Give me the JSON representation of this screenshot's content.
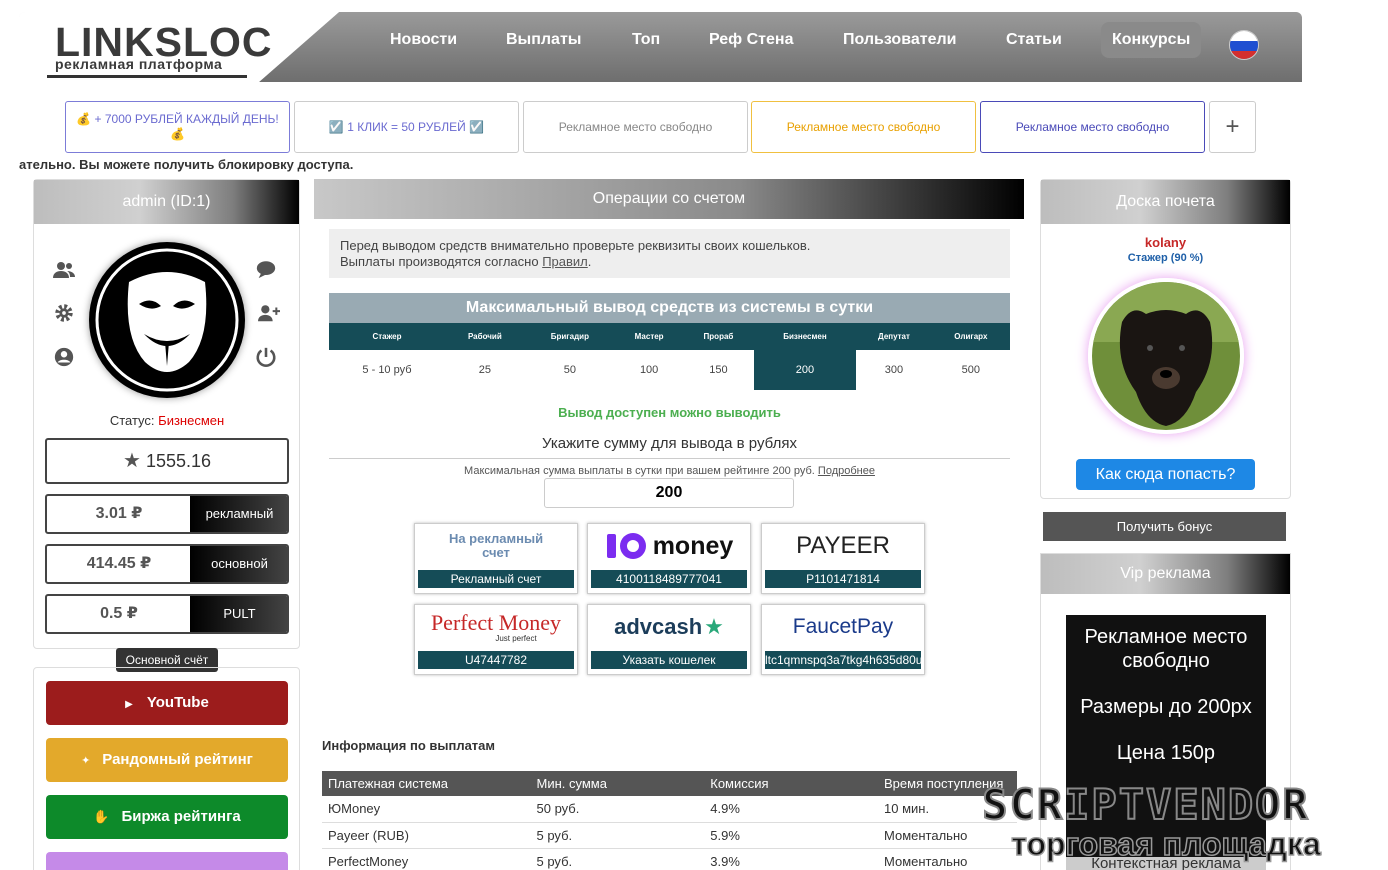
{
  "header": {
    "logo": "LINKSLOC",
    "logo_sub": "рекламная платформа",
    "nav": [
      "Новости",
      "Выплаты",
      "Топ",
      "Реф Стена",
      "Пользователи",
      "Статьи",
      "Конкурсы"
    ]
  },
  "banners": [
    "💰 + 7000 РУБЛЕЙ КАЖДЫЙ ДЕНЬ! 💰",
    "☑️ 1 КЛИК = 50 РУБЛЕЙ ☑️",
    "Рекламное место свободно",
    "Рекламное место свободно",
    "Рекламное место свободно",
    "+"
  ],
  "marquee": "ательно. Вы можете получить блокировку доступа.",
  "profile": {
    "title": "admin (ID:1)",
    "status_label": "Статус:",
    "status_value": "Бизнесмен",
    "rating": "1555.16",
    "balances": [
      {
        "value": "3.01 ₽",
        "tag": "рекламный"
      },
      {
        "value": "414.45 ₽",
        "tag": "основной"
      },
      {
        "value": "0.5 ₽",
        "tag": "PULT"
      }
    ],
    "tooltip": "Основной счёт"
  },
  "menu": [
    "YouTube",
    "Рандомный рейтинг",
    "Биржа рейтинга"
  ],
  "operations": {
    "title": "Операции со счетом",
    "notice_line1": "Перед выводом средств внимательно проверьте реквизиты своих кошельков.",
    "notice_line2": "Выплаты производятся согласно",
    "notice_link": "Правил",
    "max_title": "Максимальный вывод средств из системы в сутки",
    "ranks": [
      "Стажер",
      "Рабочий",
      "Бригадир",
      "Мастер",
      "Прораб",
      "Бизнесмен",
      "Депутат",
      "Олигарх"
    ],
    "limits": [
      "5 - 10 руб",
      "25",
      "50",
      "100",
      "150",
      "200",
      "300",
      "500"
    ],
    "available": "Вывод доступен можно выводить",
    "amount_title": "Укажите сумму для вывода в рублях",
    "max_note": "Максимальная сумма выплаты в сутки при вашем рейтинге 200 руб.",
    "max_note_link": "Подробнее",
    "amount": "200",
    "pay_labels": [
      "Рекламный счет",
      "4100118489777041",
      "P1101471814",
      "U47447782",
      "Указать кошелек",
      "ltc1qmnspq3a7tkg4h635d80u"
    ],
    "pay_logos": [
      "На рекламный счет",
      "money",
      "PAYEER",
      "Perfect Money",
      "advcash",
      "FaucetPay"
    ],
    "pm_sub": "Just perfect",
    "info_title": "Информация по выплатам",
    "table_head": [
      "Платежная система",
      "Мин. сумма",
      "Комиссия",
      "Время поступления"
    ],
    "table_rows": [
      [
        "ЮMoney",
        "50 руб.",
        "4.9%",
        "10 мин."
      ],
      [
        "Payeer (RUB)",
        "5 руб.",
        "5.9%",
        "Моментально"
      ],
      [
        "PerfectMoney",
        "5 руб.",
        "3.9%",
        "Моментально"
      ]
    ]
  },
  "honor": {
    "title": "Доска почета",
    "user": "kolany",
    "rank": "Стажер (90 %)",
    "join": "Как сюда попасть?",
    "bonus": "Получить бонус"
  },
  "vip": {
    "title": "Vip реклама",
    "line1": "Рекламное место свободно",
    "line2": "Размеры до 200px",
    "line3": "Цена 150р",
    "context": "Контекстная реклама"
  },
  "watermark": {
    "line1": "SCRIPTVENDOR",
    "line2": "торговая площадка"
  }
}
